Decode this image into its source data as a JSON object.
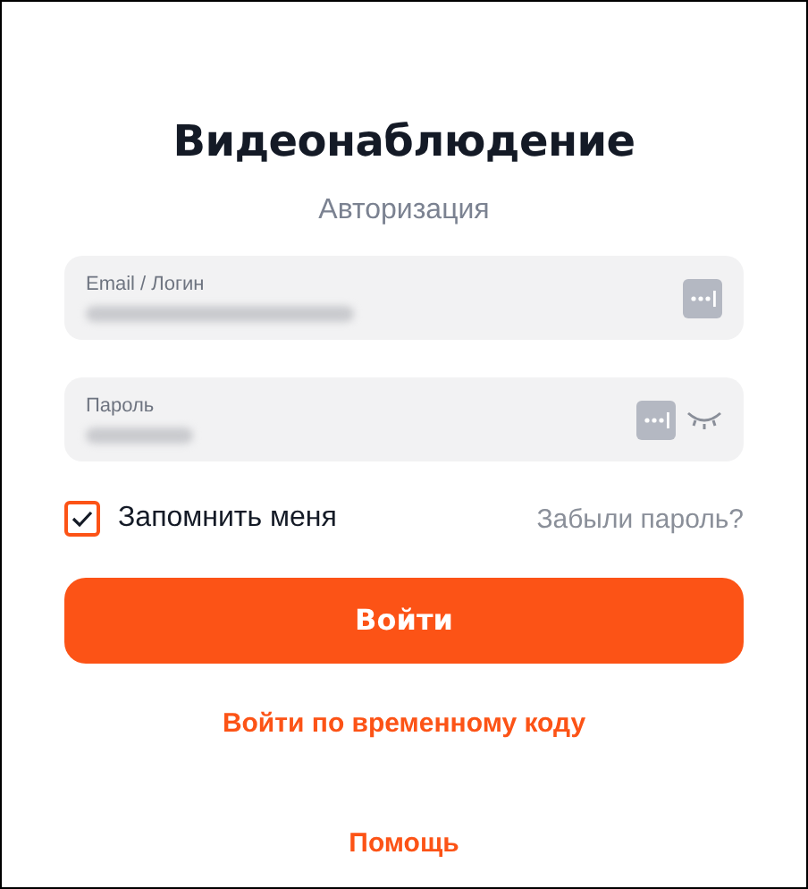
{
  "title": "Видеонаблюдение",
  "subtitle": "Авторизация",
  "fields": [
    {
      "label": "Email / Логин",
      "kind": "email"
    },
    {
      "label": "Пароль",
      "kind": "password"
    }
  ],
  "remember": {
    "label": "Запомнить меня",
    "checked": true
  },
  "forgot_link": "Забыли пароль?",
  "login_button": "Войти",
  "temp_code_link": "Войти по временному коду",
  "help_link": "Помощь"
}
